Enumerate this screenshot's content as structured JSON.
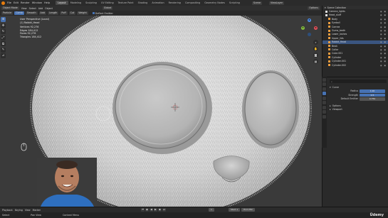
{
  "menubar": {
    "items": [
      "File",
      "Edit",
      "Render",
      "Window",
      "Help"
    ],
    "workspaces": [
      "Layout",
      "Modeling",
      "Sculpting",
      "UV Editing",
      "Texture Paint",
      "Shading",
      "Animation",
      "Rendering",
      "Compositing",
      "Geometry Nodes",
      "Scripting"
    ],
    "active_workspace": "Layout",
    "scene_label": "Scene",
    "viewlayer_label": "ViewLayer"
  },
  "header2": {
    "mode": "Object Mode",
    "view": "View",
    "select": "Select",
    "add": "Add",
    "object": "Object",
    "transform": "Global",
    "options": "Options"
  },
  "header3": {
    "items": [
      "Particle",
      "Comb",
      "Smooth",
      "Add",
      "Length",
      "Puff",
      "Cut",
      "Weight"
    ],
    "deflect": "Deflect Emitter"
  },
  "viewport": {
    "overlay_lines": [
      "User Perspective (Local)",
      "(1) Rabbit_Head",
      "",
      "Vertices   92,276",
      "Edges      184,412",
      "Faces      92,276",
      "Triangles  184,412"
    ]
  },
  "toolbar": {
    "tools": [
      "cursor-icon",
      "move-icon",
      "rotate-icon",
      "scale-icon",
      "transform-icon",
      "annotate-icon",
      "measure-icon"
    ]
  },
  "gizmo": {
    "x": "X",
    "y": "Y",
    "z": "Z"
  },
  "outliner": {
    "title": "Scene Collection",
    "rows": [
      {
        "name": "Camera_lights",
        "color": "#e0e0e0",
        "selected": false
      },
      {
        "name": "Head_stuff",
        "color": "#e0e0e0",
        "selected": false
      },
      {
        "name": "Body",
        "color": "#f0a040",
        "selected": false
      },
      {
        "name": "Eyeball",
        "color": "#f0a040",
        "selected": false
      },
      {
        "name": "Cornea",
        "color": "#f0a040",
        "selected": false
      },
      {
        "name": "Gums_teeth",
        "color": "#f0a040",
        "selected": false
      },
      {
        "name": "Lower_lashes",
        "color": "#f0a040",
        "selected": false
      },
      {
        "name": "Upper_lids",
        "color": "#f0a040",
        "selected": false
      },
      {
        "name": "Rabbit_Head",
        "color": "#f0a040",
        "selected": true
      },
      {
        "name": "Beak",
        "color": "#f0a040",
        "selected": false
      },
      {
        "name": "Collar",
        "color": "#f0a040",
        "selected": false
      },
      {
        "name": "Cube.001",
        "color": "#f0a040",
        "selected": false
      },
      {
        "name": "Cylinder",
        "color": "#f0a040",
        "selected": false
      },
      {
        "name": "Cylinder.001",
        "color": "#f0a040",
        "selected": false
      },
      {
        "name": "Cylinder.002",
        "color": "#f0a040",
        "selected": false
      }
    ]
  },
  "properties": {
    "section": "Curve",
    "rows": [
      {
        "label": "Radius",
        "value": "1.00"
      },
      {
        "label": "Strength",
        "value": "0.5"
      },
      {
        "label": "Default Emitter",
        "value": "0.750"
      }
    ],
    "sub_sections": [
      "Options",
      "Viewport"
    ]
  },
  "timeline": {
    "playback": "Playback",
    "keying": "Keying",
    "view": "View",
    "marker": "Marker",
    "current_frame": "1",
    "start_label": "Start",
    "start_value": "1",
    "end_label": "End",
    "end_value": "250"
  },
  "statusbar": {
    "left": "Select",
    "middle": "Pan View",
    "right": "Context Menu",
    "watermark": "Üdemy"
  },
  "colors": {
    "accent": "#4772b3",
    "viewport_bg": "#3a3a3a",
    "fur": "#d9d9d9",
    "selection": "#f0a040"
  }
}
